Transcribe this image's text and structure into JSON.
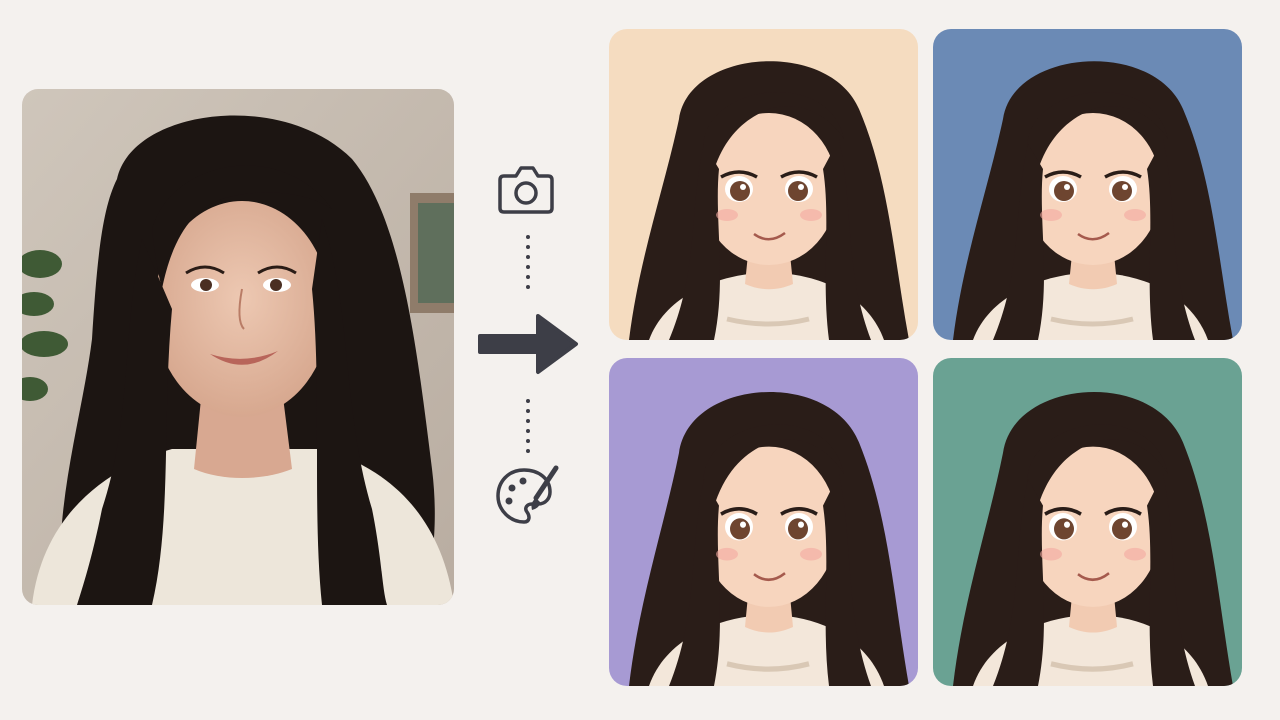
{
  "colors": {
    "page_background": "#f4f1ee",
    "icon_color": "#3d3e47",
    "art_backgrounds": [
      "#f5dcc0",
      "#6b8ab5",
      "#a79ad3",
      "#6aa293"
    ]
  },
  "icons": {
    "top": "camera-icon",
    "middle": "arrow-right-icon",
    "bottom": "palette-icon"
  },
  "images": {
    "source": "photo-portrait",
    "outputs": [
      "anime-portrait-peach",
      "anime-portrait-blue",
      "anime-portrait-lavender",
      "anime-portrait-teal"
    ]
  }
}
